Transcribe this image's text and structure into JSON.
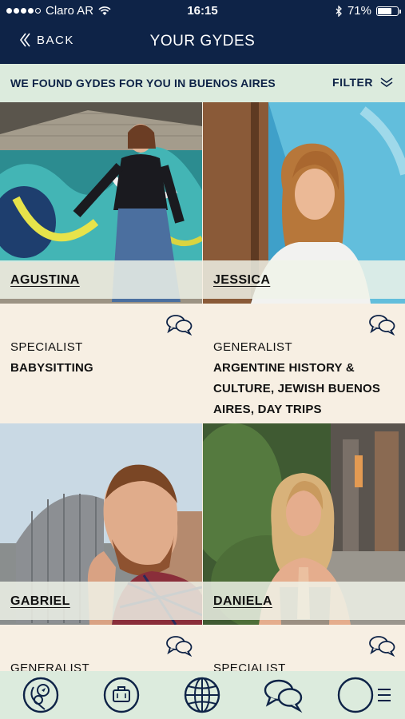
{
  "status_bar": {
    "carrier": "Claro AR",
    "time": "16:15",
    "battery": "71%",
    "battery_level": 0.71
  },
  "nav": {
    "back_label": "BACK",
    "title": "YOUR GYDES"
  },
  "filter_bar": {
    "message": "WE FOUND GYDES FOR YOU IN BUENOS AIRES",
    "filter_label": "FILTER"
  },
  "gydes": [
    {
      "name": "AGUSTINA",
      "type": "SPECIALIST",
      "specialty": "BABYSITTING"
    },
    {
      "name": "JESSICA",
      "type": "GENERALIST",
      "specialty": "ARGENTINE HISTORY & CULTURE, JEWISH BUENOS AIRES, DAY TRIPS"
    },
    {
      "name": "GABRIEL",
      "type": "GENERALIST",
      "specialty": ""
    },
    {
      "name": "DANIELA",
      "type": "SPECIALIST",
      "specialty": ""
    }
  ],
  "tab_bar": {
    "items": [
      "explore-tab",
      "trips-tab",
      "globe-tab",
      "messages-tab",
      "profile-menu-tab"
    ]
  },
  "colors": {
    "navy": "#0E2347",
    "mint": "#DCEBDD",
    "cream": "#F7EFE3"
  }
}
